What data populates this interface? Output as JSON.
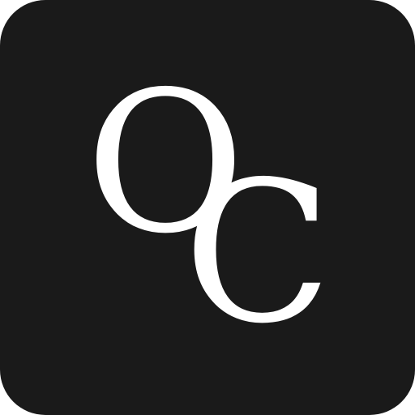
{
  "icon": {
    "letters": {
      "first": "O",
      "second": "C"
    },
    "colors": {
      "background": "#1a1a1a",
      "foreground": "#ffffff"
    }
  }
}
